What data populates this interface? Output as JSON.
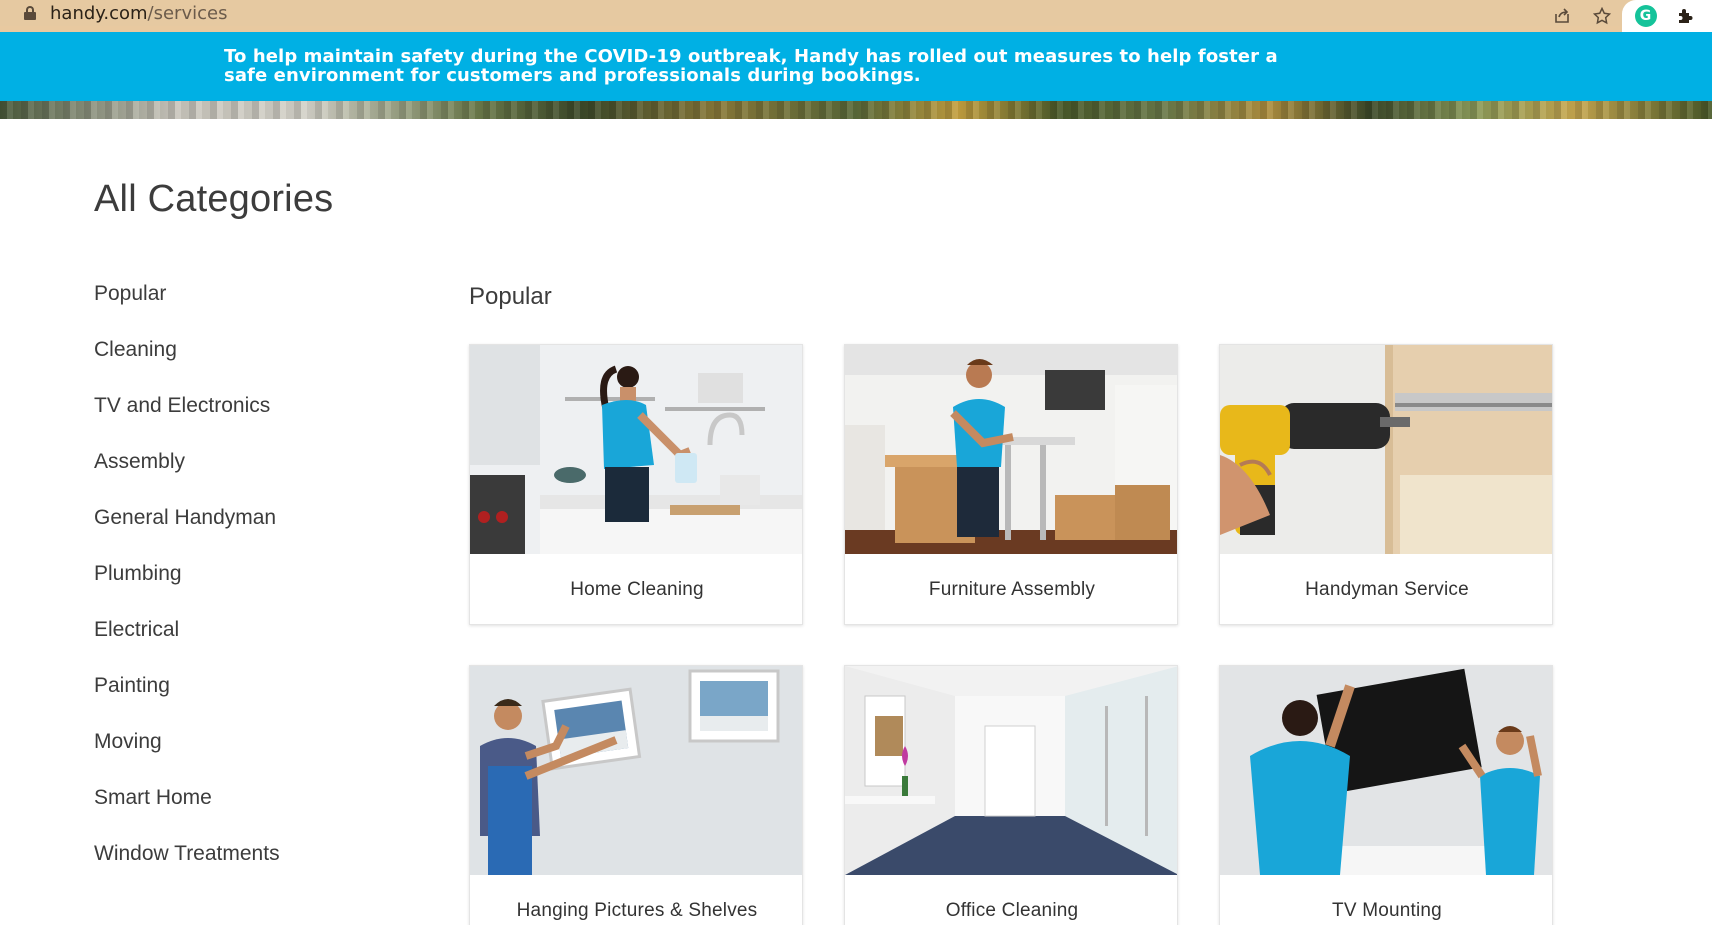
{
  "browser": {
    "url_host": "handy.com",
    "url_path": "/services",
    "icons": [
      "lock-icon",
      "share-icon",
      "star-icon",
      "grammarly-icon",
      "extensions-icon"
    ]
  },
  "banner": {
    "text": "To help maintain safety during the COVID-19 outbreak, Handy has rolled out measures to help foster a safe environment for customers and professionals during bookings.",
    "color": "#00b0e4"
  },
  "page": {
    "title": "All Categories"
  },
  "categories": [
    {
      "label": "Popular"
    },
    {
      "label": "Cleaning"
    },
    {
      "label": "TV and Electronics"
    },
    {
      "label": "Assembly"
    },
    {
      "label": "General Handyman"
    },
    {
      "label": "Plumbing"
    },
    {
      "label": "Electrical"
    },
    {
      "label": "Painting"
    },
    {
      "label": "Moving"
    },
    {
      "label": "Smart Home"
    },
    {
      "label": "Window Treatments"
    }
  ],
  "section": {
    "title": "Popular"
  },
  "services": [
    {
      "label": "Home Cleaning"
    },
    {
      "label": "Furniture Assembly"
    },
    {
      "label": "Handyman Service"
    },
    {
      "label": "Hanging Pictures & Shelves"
    },
    {
      "label": "Office Cleaning"
    },
    {
      "label": "TV Mounting"
    }
  ]
}
